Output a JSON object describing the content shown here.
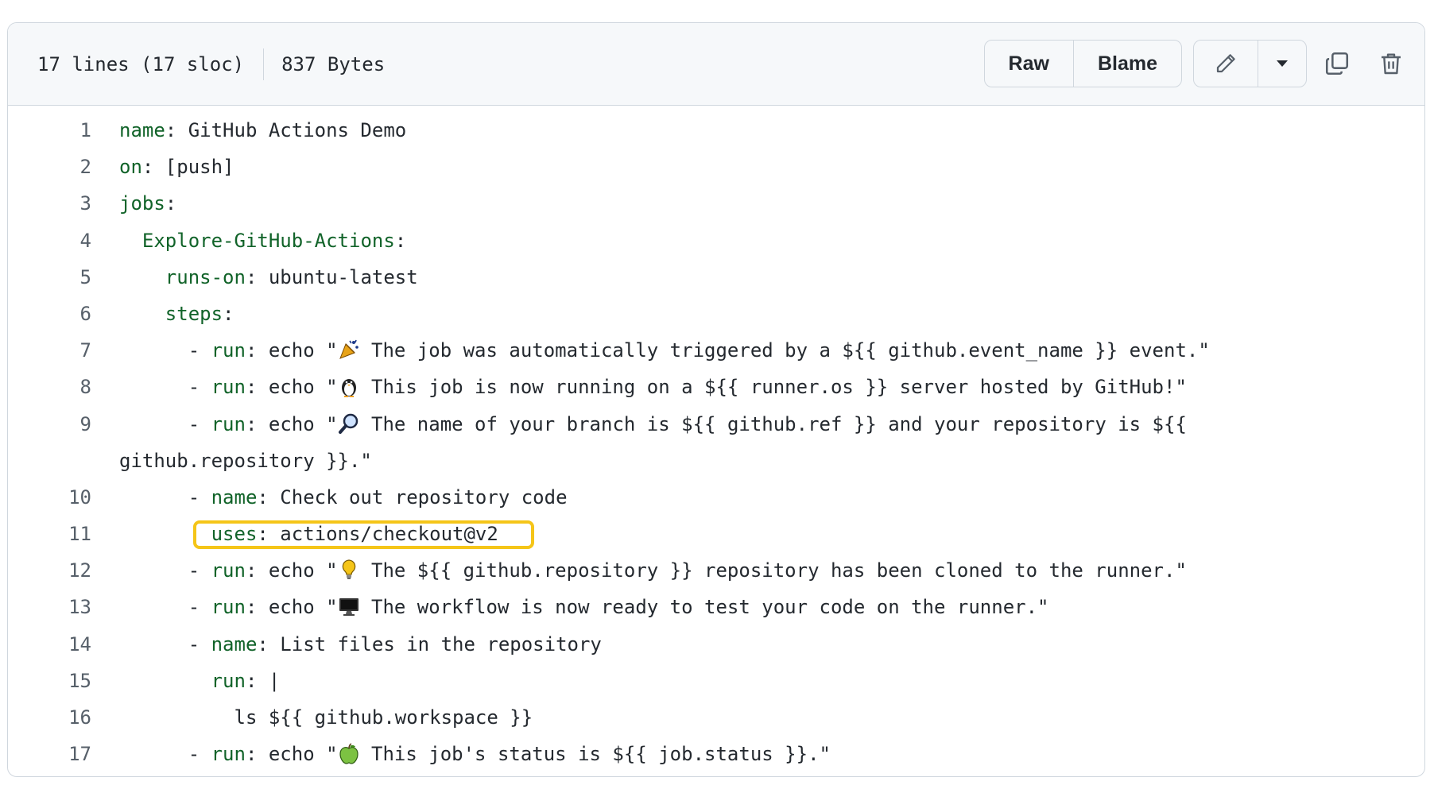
{
  "file": {
    "lines_info": "17 lines (17 sloc)",
    "size": "837 Bytes"
  },
  "toolbar": {
    "raw_label": "Raw",
    "blame_label": "Blame",
    "icons": [
      "pencil-icon",
      "triangle-down-icon",
      "copy-icon",
      "trash-icon"
    ]
  },
  "code": {
    "lines": [
      {
        "n": "1",
        "pre": "",
        "key": "name",
        "rest": ": GitHub Actions Demo"
      },
      {
        "n": "2",
        "pre": "",
        "key": "on",
        "rest": ": [push]"
      },
      {
        "n": "3",
        "pre": "",
        "key": "jobs",
        "rest": ":"
      },
      {
        "n": "4",
        "pre": "  ",
        "key": "Explore-GitHub-Actions",
        "rest": ":"
      },
      {
        "n": "5",
        "pre": "    ",
        "key": "runs-on",
        "rest": ": ubuntu-latest"
      },
      {
        "n": "6",
        "pre": "    ",
        "key": "steps",
        "rest": ":"
      },
      {
        "n": "7",
        "pre": "      - ",
        "key": "run",
        "rest_a": ": echo \"",
        "emoji": "party-popper",
        "rest": " The job was automatically triggered by a ${{ github.event_name }} event.\""
      },
      {
        "n": "8",
        "pre": "      - ",
        "key": "run",
        "rest_a": ": echo \"",
        "emoji": "penguin",
        "rest": " This job is now running on a ${{ runner.os }} server hosted by GitHub!\""
      },
      {
        "n": "9",
        "pre": "      - ",
        "key": "run",
        "rest_a": ": echo \"",
        "emoji": "magnifier",
        "rest": " The name of your branch is ${{ github.ref }} and your repository is ${{ github.repository }}.\""
      },
      {
        "n": "10",
        "pre": "      - ",
        "key": "name",
        "rest": ": Check out repository code"
      },
      {
        "n": "11",
        "pre": "        ",
        "key": "uses",
        "rest": ": actions/checkout@v2"
      },
      {
        "n": "12",
        "pre": "      - ",
        "key": "run",
        "rest_a": ": echo \"",
        "emoji": "light-bulb",
        "rest": " The ${{ github.repository }} repository has been cloned to the runner.\""
      },
      {
        "n": "13",
        "pre": "      - ",
        "key": "run",
        "rest_a": ": echo \"",
        "emoji": "desktop-computer",
        "rest": " The workflow is now ready to test your code on the runner.\""
      },
      {
        "n": "14",
        "pre": "      - ",
        "key": "name",
        "rest": ": List files in the repository"
      },
      {
        "n": "15",
        "pre": "        ",
        "key": "run",
        "rest": ": |"
      },
      {
        "n": "16",
        "pre": "          ",
        "key": "",
        "rest": "ls ${{ github.workspace }}"
      },
      {
        "n": "17",
        "pre": "      - ",
        "key": "run",
        "rest_a": ": echo \"",
        "emoji": "green-apple",
        "rest": " This job's status is ${{ job.status }}.\""
      }
    ]
  },
  "colors": {
    "key": "#116329",
    "highlight": "#f5c518"
  }
}
